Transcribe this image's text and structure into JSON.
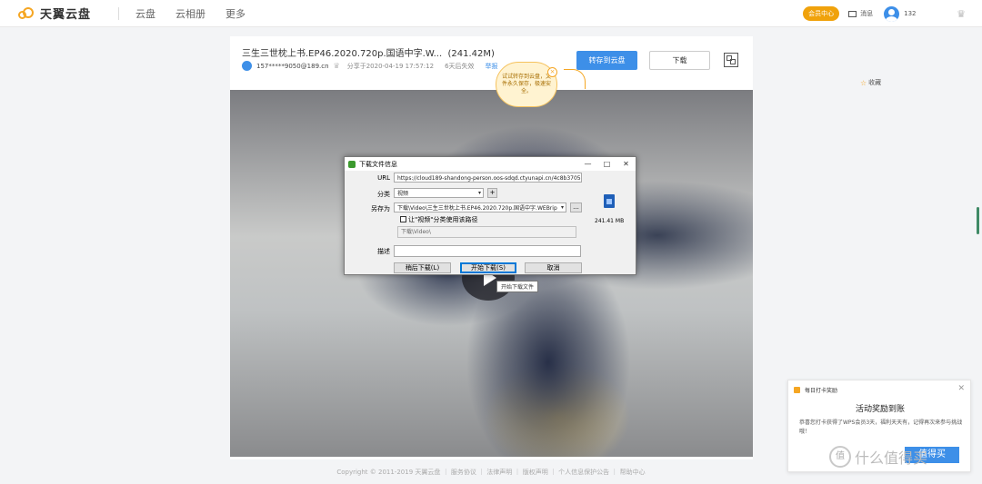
{
  "nav": {
    "brand": "天翼云盘",
    "links": [
      "云盘",
      "云相册",
      "更多"
    ],
    "vip": "会员中心",
    "messages": "消息",
    "user": "132"
  },
  "file": {
    "title": "三生三世枕上书.EP46.2020.720p.国语中字.W...",
    "size": "(241.42M)",
    "sharer": "157*****9050@189.cn",
    "shared_at": "分享于2020-04-19 17:57:12",
    "expiry": "6天后失效",
    "report": "举报",
    "save_button": "转存到云盘",
    "download_button": "下载"
  },
  "bubble": {
    "text": "试试转存到云盘，文件永久保存，极速安全。",
    "close": "×"
  },
  "favorite": "收藏",
  "footer": "Copyright © 2011-2019 天翼云盘 ｜ 服务协议 ｜ 法律声明 ｜ 版权声明 ｜ 个人信息保护公告 ｜ 帮助中心",
  "dialog": {
    "title": "下载文件信息",
    "url_label": "URL",
    "url_value": "https://cloud189-shandong-person.oos-sdqd.ctyunapi.cn/4c8b3705-dd16-",
    "category_label": "分类",
    "category_value": "视频",
    "add_button": "+",
    "save_as_label": "另存为",
    "save_as_value": "下载\\Video\\三生三世枕上书.EP46.2020.720p.国语中字.WEBrip",
    "browse_button": "...",
    "checkbox_label": "让\"视频\"分类使用该路径",
    "path_value": "下载\\Video\\",
    "desc_label": "描述",
    "desc_value": "",
    "file_size": "241.41 MB",
    "later_button": "稍后下载(L)",
    "start_button": "开始下载(S)",
    "cancel_button": "取消",
    "tooltip": "开始下载文件",
    "ctrl_min": "—",
    "ctrl_max": "□",
    "ctrl_close": "✕"
  },
  "popup": {
    "header": "每日打卡奖励",
    "title": "活动奖励到账",
    "body": "恭喜您打卡获得了WPS会员3天，福利天天有，记得再次来参与挑战哦！",
    "button": "值得买",
    "close": "✕"
  },
  "watermark": "什么值得买",
  "watermark_badge": "值"
}
